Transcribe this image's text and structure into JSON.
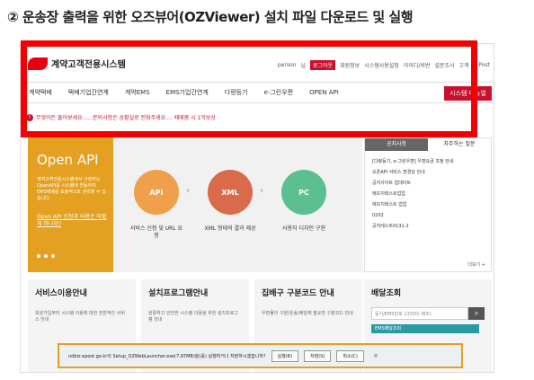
{
  "heading": "② 운송장 출력을 위한 오즈뷰어(OZViewer) 설치 파일 다운로드 및 실행",
  "site": {
    "logo_text": "계약고객전용시스템",
    "util": [
      "person",
      "님",
      "로그아웃",
      "회원정보",
      "시스템사용설정",
      "아이디/비번",
      "설문조사",
      "고객",
      "e-Post"
    ],
    "nav": [
      "계약택배",
      "택배기업간연계",
      "계약EMS",
      "EMS기업간연계",
      "다량등기",
      "e-그린우편",
      "OPEN API"
    ],
    "service_button": "시스템 매뉴얼",
    "notice": "무엇이든 물어보세요......문의사항은 상황실로 전화주세요.... 떼떼봄 시 1악보상"
  },
  "api": {
    "title": "Open API",
    "desc": "계약고객전용시스템에서 구현하는 OpenAPI를 시스템에 연동하여 EMS택배를 효율적으로 관리할 수 있습니다.",
    "link": "Open API 신청과 이용은 어떻게 하나요?",
    "steps": [
      {
        "icon": "API",
        "label": "서비스 신청 및 URL 요청"
      },
      {
        "icon": "XML",
        "label": "XML 형태의 결과 제공"
      },
      {
        "icon": "PC",
        "label": "사용자 디자인 구현"
      }
    ]
  },
  "side": {
    "tabs": [
      "공지사항",
      "자주하는 질문"
    ],
    "items": [
      "[다량등기, e-그린우편] 우편요금 조정 안내",
      "오픈API 서비스 변경상 안내",
      "공지사이트 업데이트",
      "에뜨지테스트업업",
      "에뜨지테스트 업업",
      "0202",
      "공지테스트0131-2"
    ],
    "more": "더보기 +"
  },
  "cards": [
    {
      "title": "서비스이용안내",
      "text": "회원가입부터 시스템 이용에 대한 전반적인 서비스 안내"
    },
    {
      "title": "설치프로그램안내",
      "text": "원활하고 안전한 시스템 이용을 위한 설치프로그램 안내"
    },
    {
      "title": "집배구 구분코드 안내",
      "text": "우편물의 구분/운송/배달에 필요한 구분코드 안내"
    }
  ],
  "track": {
    "title": "배달조회",
    "placeholder": "등기/EMS번호 13자리(-제외)",
    "search_icon": "⌕",
    "item": "EMS배달조회"
  },
  "download": {
    "text": "ndbiz.epost.go.kr의 Setup_OZWebLauncher.exe(7.97MB)을(를) 실행하거나 저장하시겠습니까?",
    "run": "실행(R)",
    "save": "저장(S)",
    "cancel": "취소(C)",
    "close": "×"
  }
}
